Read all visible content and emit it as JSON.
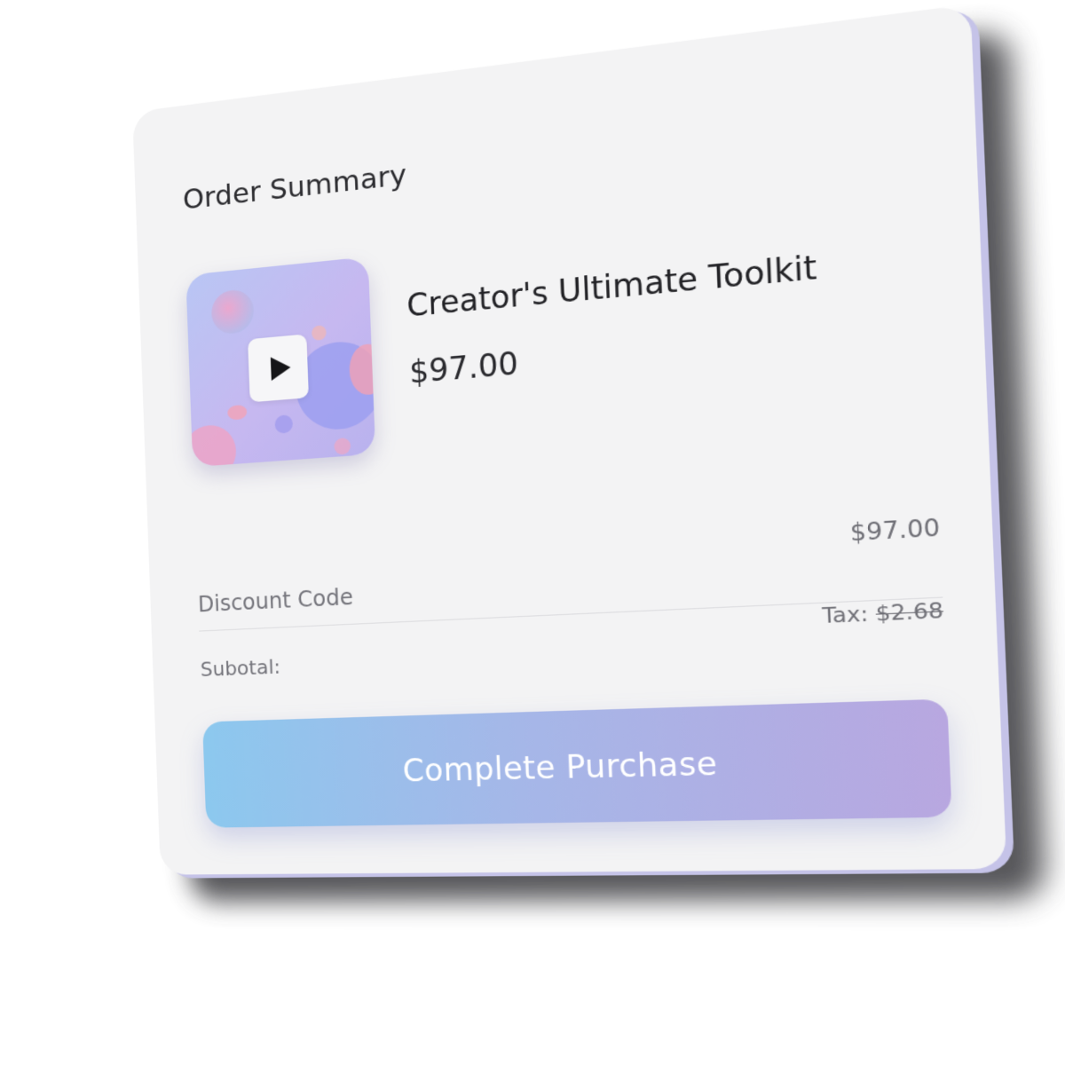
{
  "order_summary": {
    "title": "Order Summary"
  },
  "product": {
    "name": "Creator's Ultimate Toolkit",
    "price": "$97.00",
    "thumbnail_icon": "play-icon"
  },
  "totals": {
    "amount": "$97.00",
    "discount_label": "Discount Code",
    "subtotal_label": "Subotal:",
    "tax_label": "Tax:",
    "tax_amount": "$2.68"
  },
  "actions": {
    "purchase_label": "Complete Purchase"
  },
  "colors": {
    "card_background": "#f3f3f4",
    "button_gradient_start": "#8cc8ee",
    "button_gradient_end": "#b8a7e0",
    "text_primary": "#222226",
    "text_secondary": "#74747b"
  }
}
